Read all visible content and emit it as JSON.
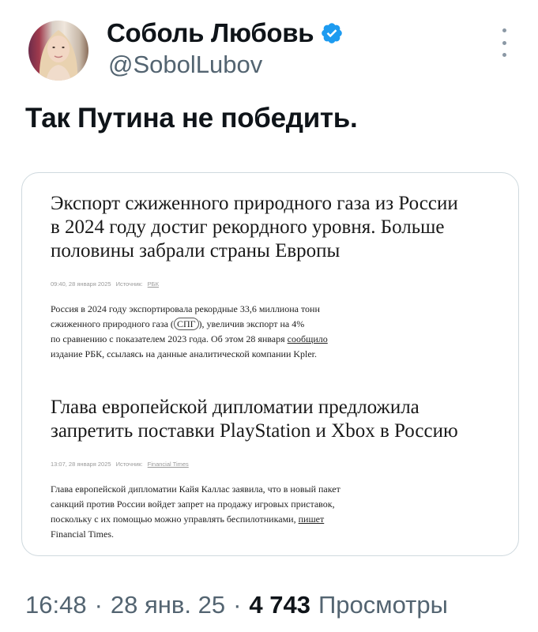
{
  "author": {
    "display_name": "Соболь Любовь",
    "handle": "@SobolLubov",
    "verified_color": "#1d9bf0"
  },
  "tweet": {
    "text": "Так Путина не победить."
  },
  "card": {
    "article1": {
      "headline": "Экспорт сжиженного природного газа из России\nв 2024 году достиг рекордного уровня. Больше\nполовины забрали страны Европы",
      "time": "09:40, 28 января 2025",
      "source_label": "Источник:",
      "source": "РБК",
      "body_start": "Россия в 2024 году экспортировала рекордные 33,6 миллиона тонн\nсжиженного природного газа (",
      "body_boxed": "СПГ",
      "body_mid": "), увеличив экспорт на 4%\nпо сравнению с показателем 2023 года. Об этом 28 января ",
      "body_link": "сообщило",
      "body_end": "\nиздание РБК, ссылаясь на данные аналитической компании Kpler."
    },
    "article2": {
      "headline": "Глава европейской дипломатии предложила\nзапретить поставки PlayStation и Xbox в Россию",
      "time": "13:07, 28 января 2025",
      "source_label": "Источник:",
      "source": "Financial Times",
      "body_start": "Глава европейской дипломатии Кайя Каллас заявила, что в новый пакет\nсанкций против России войдет запрет на продажу игровых приставок,\nпоскольку с их помощью можно управлять беспилотниками, ",
      "body_link": "пишет",
      "body_end": "\nFinancial Times."
    }
  },
  "footer": {
    "time": "16:48",
    "sep1": "·",
    "date": "28 янв. 25",
    "sep2": "·",
    "views_count": "4 743",
    "views_label": "Просмотры"
  }
}
